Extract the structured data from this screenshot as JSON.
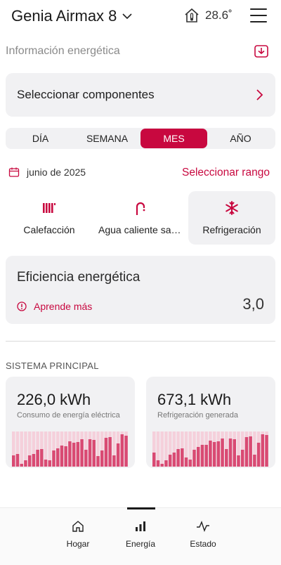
{
  "header": {
    "device_name": "Genia Airmax 8",
    "temperature": "28.6˚"
  },
  "section_title": "Información energética",
  "select_components_label": "Seleccionar componentes",
  "period_tabs": [
    {
      "label": "DÍA",
      "active": false
    },
    {
      "label": "SEMANA",
      "active": false
    },
    {
      "label": "MES",
      "active": true
    },
    {
      "label": "AÑO",
      "active": false
    }
  ],
  "date_label": "junio de 2025",
  "range_link": "Seleccionar rango",
  "components": [
    {
      "label": "Calefacción",
      "icon": "radiator-icon",
      "selected": false
    },
    {
      "label": "Agua caliente sanitaria",
      "icon": "faucet-icon",
      "selected": false
    },
    {
      "label": "Refrigeración",
      "icon": "snowflake-icon",
      "selected": true
    }
  ],
  "efficiency": {
    "title": "Eficiencia energética",
    "learn_more": "Aprende más",
    "value": "3,0"
  },
  "system_title": "SISTEMA PRINCIPAL",
  "stats": {
    "consumption": {
      "value": "226,0 kWh",
      "caption": "Consumo de energía eléctrica",
      "bars": [
        0.32,
        0.36,
        0.08,
        0.18,
        0.32,
        0.36,
        0.48,
        0.5,
        0.2,
        0.18,
        0.46,
        0.52,
        0.6,
        0.58,
        0.72,
        0.68,
        0.7,
        0.78,
        0.48,
        0.78,
        0.76,
        0.3,
        0.46,
        0.82,
        0.84,
        0.32,
        0.66,
        0.92,
        0.88
      ]
    },
    "generation": {
      "value": "673,1 kWh",
      "caption": "Refrigeración generada",
      "bars": [
        0.4,
        0.18,
        0.08,
        0.18,
        0.34,
        0.4,
        0.5,
        0.52,
        0.26,
        0.2,
        0.48,
        0.56,
        0.62,
        0.62,
        0.74,
        0.7,
        0.72,
        0.8,
        0.5,
        0.8,
        0.78,
        0.32,
        0.48,
        0.84,
        0.86,
        0.34,
        0.68,
        0.92,
        0.9
      ]
    }
  },
  "colors": {
    "accent": "#c8083f",
    "bar": "#d94a73",
    "bar_track": "#f5d0db"
  },
  "nav": [
    {
      "label": "Hogar",
      "icon": "home-icon"
    },
    {
      "label": "Energía",
      "icon": "bar-chart-icon",
      "active": true
    },
    {
      "label": "Estado",
      "icon": "pulse-icon"
    }
  ]
}
